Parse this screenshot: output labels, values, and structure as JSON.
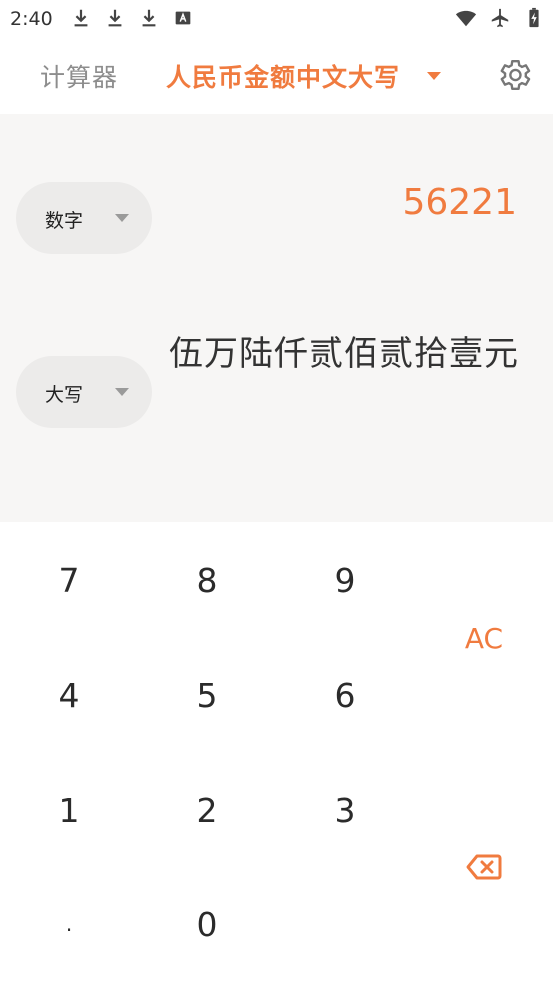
{
  "status_bar": {
    "time": "2:40",
    "icons_left": [
      "download-icon",
      "download-icon",
      "download-icon",
      "keyboard-a-icon"
    ],
    "icons_right": [
      "wifi-icon",
      "airplane-icon",
      "battery-charging-icon"
    ]
  },
  "header": {
    "tab_calculator": "计算器",
    "tab_rmb": "人民币金额中文大写",
    "accent_color": "#f07b3f"
  },
  "display": {
    "number_label": "数字",
    "number_value": "56221",
    "capital_label": "大写",
    "capital_value": "伍万陆仟贰佰贰拾壹元"
  },
  "keypad": {
    "k7": "7",
    "k8": "8",
    "k9": "9",
    "k4": "4",
    "k5": "5",
    "k6": "6",
    "k1": "1",
    "k2": "2",
    "k3": "3",
    "kdot": ".",
    "k0": "0",
    "ac": "AC"
  }
}
